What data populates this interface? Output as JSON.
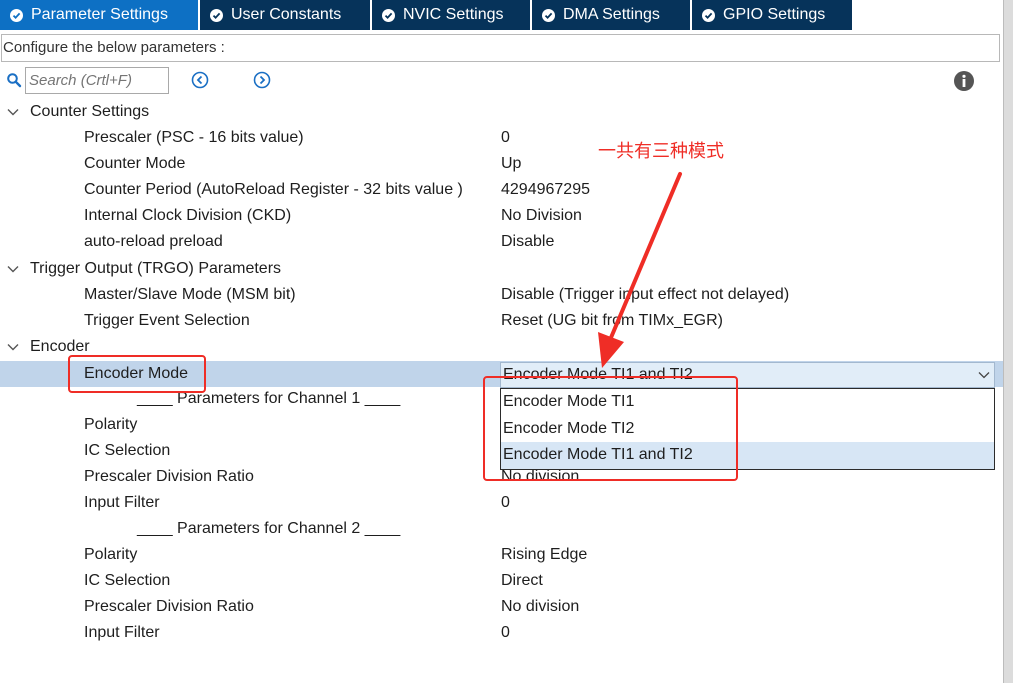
{
  "tabs": [
    {
      "label": "Parameter Settings",
      "active": true
    },
    {
      "label": "User Constants",
      "active": false
    },
    {
      "label": "NVIC Settings",
      "active": false
    },
    {
      "label": "DMA Settings",
      "active": false
    },
    {
      "label": "GPIO Settings",
      "active": false
    }
  ],
  "description": "Configure the below parameters :",
  "search": {
    "placeholder": "Search (Crtl+F)"
  },
  "icons": {
    "search": "search-icon",
    "prev": "circle-left-icon",
    "next": "circle-right-icon",
    "info": "info-icon",
    "expand": "chevron-down-icon"
  },
  "groups": {
    "counter": {
      "title": "Counter Settings",
      "rows": [
        {
          "label": "Prescaler (PSC - 16 bits value)",
          "value": "0"
        },
        {
          "label": "Counter Mode",
          "value": "Up"
        },
        {
          "label": "Counter Period (AutoReload Register - 32 bits value )",
          "value": "4294967295"
        },
        {
          "label": "Internal Clock Division (CKD)",
          "value": "No Division"
        },
        {
          "label": "auto-reload preload",
          "value": "Disable"
        }
      ]
    },
    "trgo": {
      "title": "Trigger Output (TRGO) Parameters",
      "rows": [
        {
          "label": "Master/Slave Mode (MSM bit)",
          "value": "Disable (Trigger input effect not delayed)"
        },
        {
          "label": "Trigger Event Selection",
          "value": "Reset (UG bit from TIMx_EGR)"
        }
      ]
    },
    "encoder": {
      "title": "Encoder",
      "mode_label": "Encoder Mode",
      "mode_value": "Encoder Mode TI1 and TI2",
      "mode_options": [
        "Encoder Mode TI1",
        "Encoder Mode TI2",
        "Encoder Mode TI1 and TI2"
      ],
      "ch1_header": "____ Parameters for Channel 1 ____",
      "ch1_rows": [
        {
          "label": "Polarity",
          "value": ""
        },
        {
          "label": "IC Selection",
          "value": ""
        },
        {
          "label": "Prescaler Division Ratio",
          "value": "No division"
        },
        {
          "label": "Input Filter",
          "value": "0"
        }
      ],
      "ch2_header": "____ Parameters for Channel 2 ____",
      "ch2_rows": [
        {
          "label": "Polarity",
          "value": "Rising Edge"
        },
        {
          "label": "IC Selection",
          "value": "Direct"
        },
        {
          "label": "Prescaler Division Ratio",
          "value": "No division"
        },
        {
          "label": "Input Filter",
          "value": "0"
        }
      ]
    }
  },
  "annotation": {
    "text": "一共有三种模式",
    "color": "#ef2d26"
  },
  "colors": {
    "tab_active": "#0d70c4",
    "tab_inactive": "#06335a",
    "row_selected": "#c0d4ea",
    "highlight": "#ef2d26"
  }
}
